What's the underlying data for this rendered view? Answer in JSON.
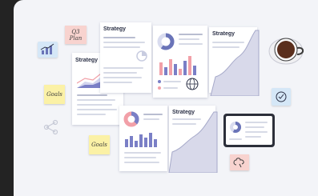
{
  "notes": {
    "plan": "Q3\nPlan",
    "goals_left": "Goals",
    "goals_bottom": "Goals"
  },
  "documents": {
    "top_center_title": "Strategy",
    "left_title": "Strategy",
    "right_folder_title": "Strategy",
    "bottom_folder_title": "Strategy"
  },
  "colors": {
    "background": "#232323",
    "canvas": "#f3f4f8",
    "accent_purple": "#7a7fc6",
    "accent_pink": "#f2a0a8",
    "note_yellow": "#fbf1a6",
    "note_pink": "#f8d3cf",
    "icon_blue": "#d5e7f7"
  },
  "icons": [
    "chart-icon",
    "share-icon",
    "globe-icon",
    "pie-chart-icon",
    "check-icon",
    "brain-icon",
    "coffee-cup-icon",
    "tablet-icon"
  ]
}
